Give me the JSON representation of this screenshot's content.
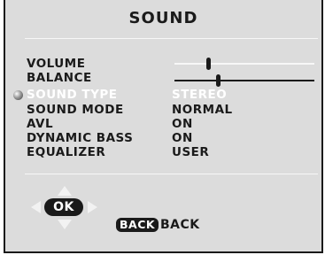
{
  "menu": {
    "title": "SOUND",
    "items": [
      {
        "label": "VOLUME",
        "type": "slider",
        "level": 0.24
      },
      {
        "label": "BALANCE",
        "type": "slider",
        "level": 0.31
      },
      {
        "label": "SOUND TYPE",
        "type": "value",
        "value": "STEREO",
        "selected": true
      },
      {
        "label": "SOUND MODE",
        "type": "value",
        "value": "NORMAL"
      },
      {
        "label": "AVL",
        "type": "value",
        "value": "ON"
      },
      {
        "label": "DYNAMIC BASS",
        "type": "value",
        "value": "ON"
      },
      {
        "label": "EQUALIZER",
        "type": "value",
        "value": "USER"
      }
    ]
  },
  "nav": {
    "ok_label": "OK",
    "back_badge": "BACK",
    "back_label": "BACK"
  },
  "colors": {
    "background": "#dcdcdc",
    "text": "#1a1a1a",
    "highlight_text": "#ffffff",
    "divider": "#f7f7f7"
  },
  "icons": {
    "cursor": "selection-ball-icon",
    "arrows": [
      "arrow-up-icon",
      "arrow-down-icon",
      "arrow-left-icon",
      "arrow-right-icon"
    ]
  }
}
